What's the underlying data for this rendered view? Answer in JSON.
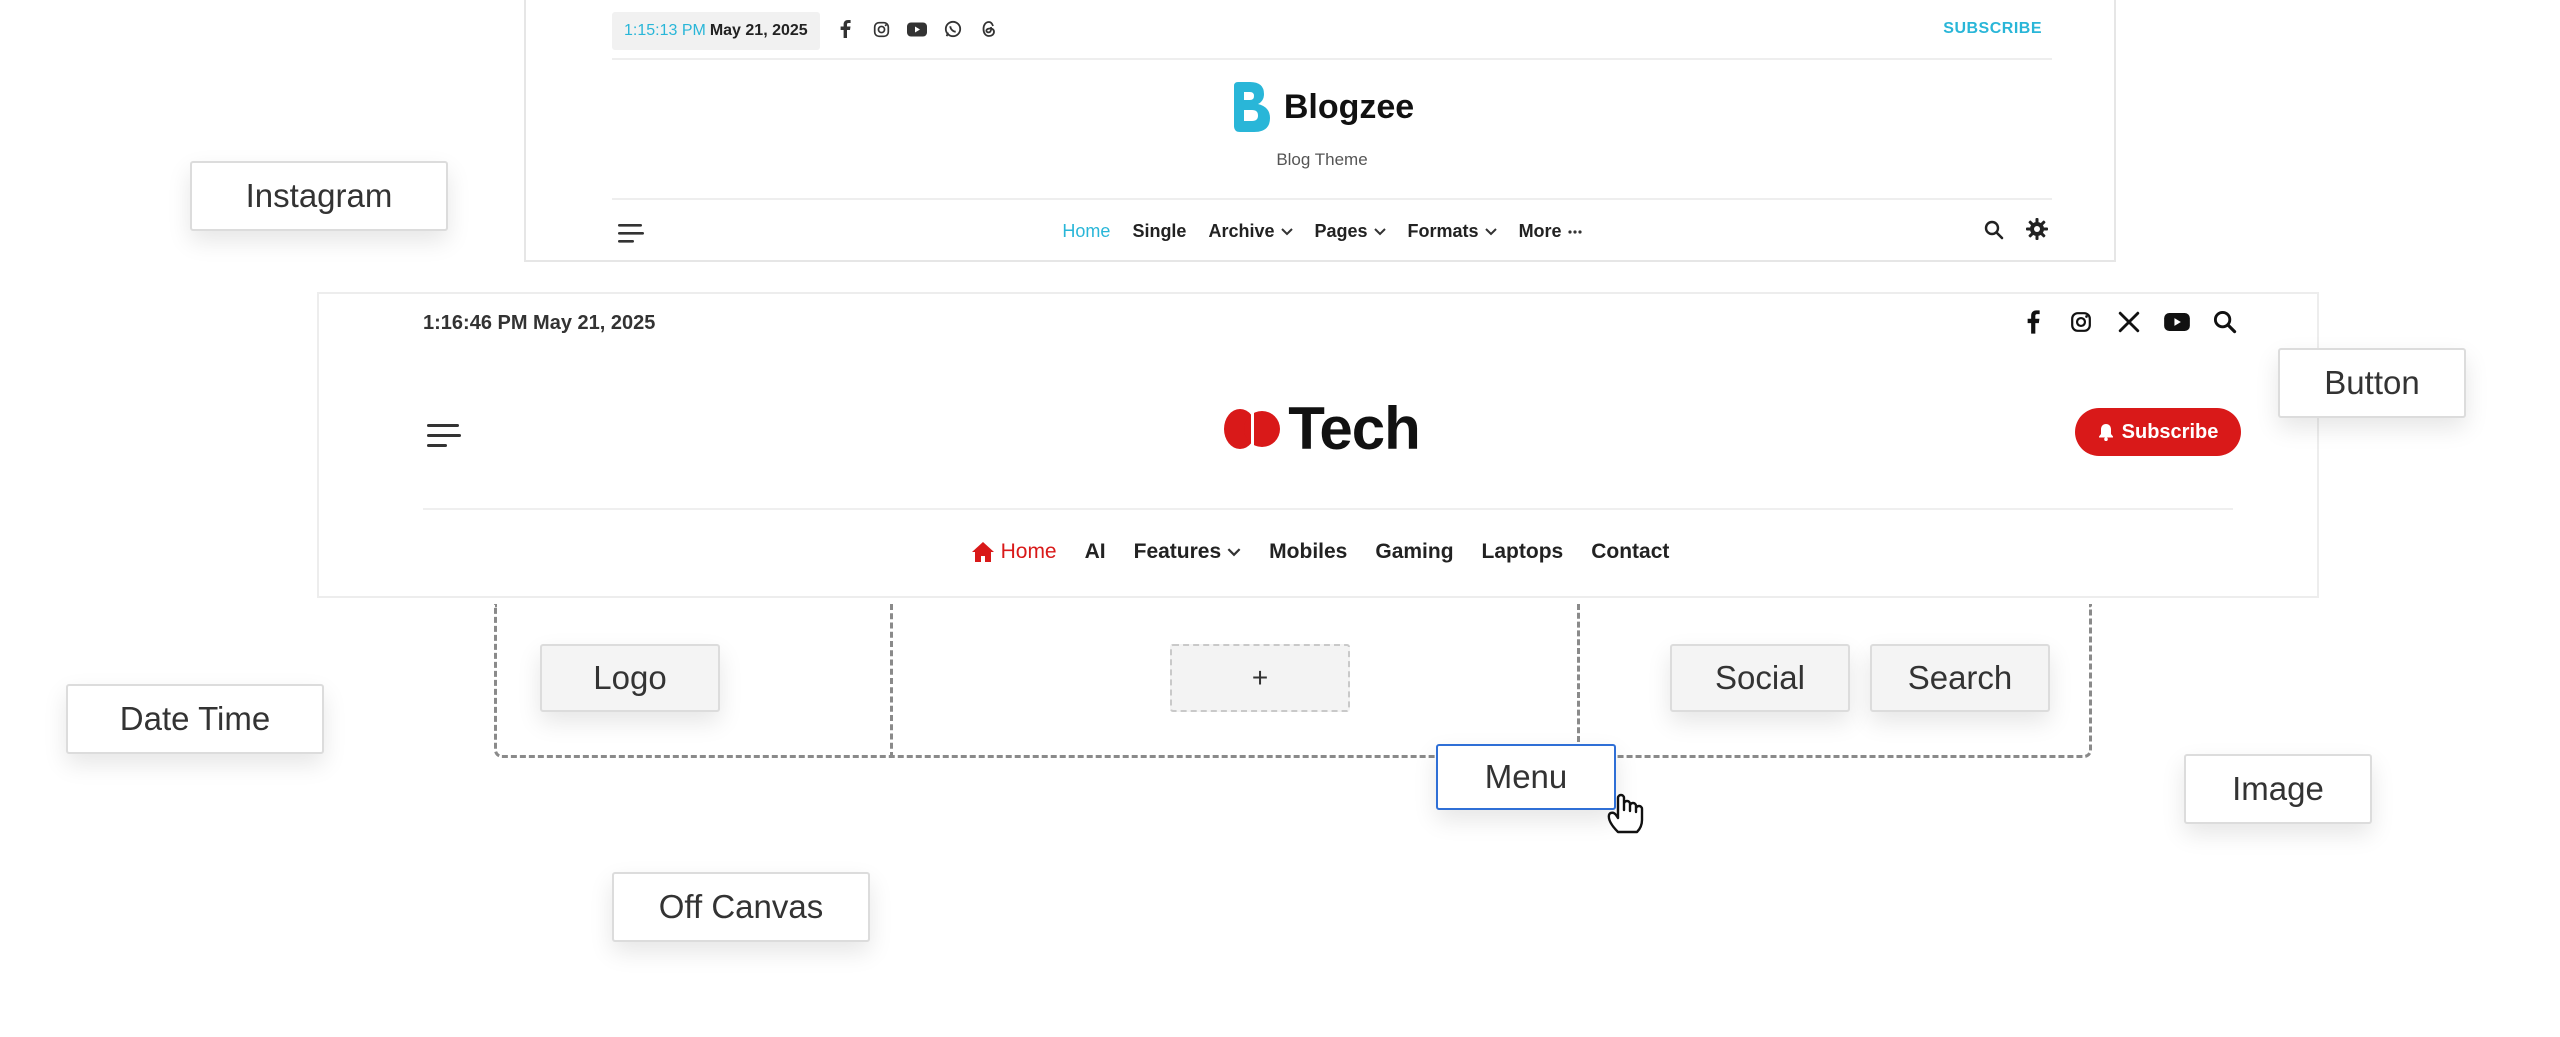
{
  "blogzee": {
    "time": "1:15:13 PM",
    "date": "May 21, 2025",
    "subscribe": "SUBSCRIBE",
    "title": "Blogzee",
    "tagline": "Blog Theme",
    "nav": [
      "Home",
      "Single",
      "Archive",
      "Pages",
      "Formats",
      "More"
    ],
    "accent": "#29b6d8"
  },
  "tech": {
    "datetime": "1:16:46 PM May 21, 2025",
    "title": "Tech",
    "subscribe": "Subscribe",
    "nav": [
      "Home",
      "AI",
      "Features",
      "Mobiles",
      "Gaming",
      "Laptops",
      "Contact"
    ],
    "accent": "#d91919"
  },
  "builder": {
    "logo": "Logo",
    "plus": "+",
    "social": "Social",
    "search": "Search",
    "menu": "Menu"
  },
  "chips": {
    "instagram": "Instagram",
    "button": "Button",
    "date_time": "Date Time",
    "image": "Image",
    "off_canvas": "Off Canvas"
  }
}
